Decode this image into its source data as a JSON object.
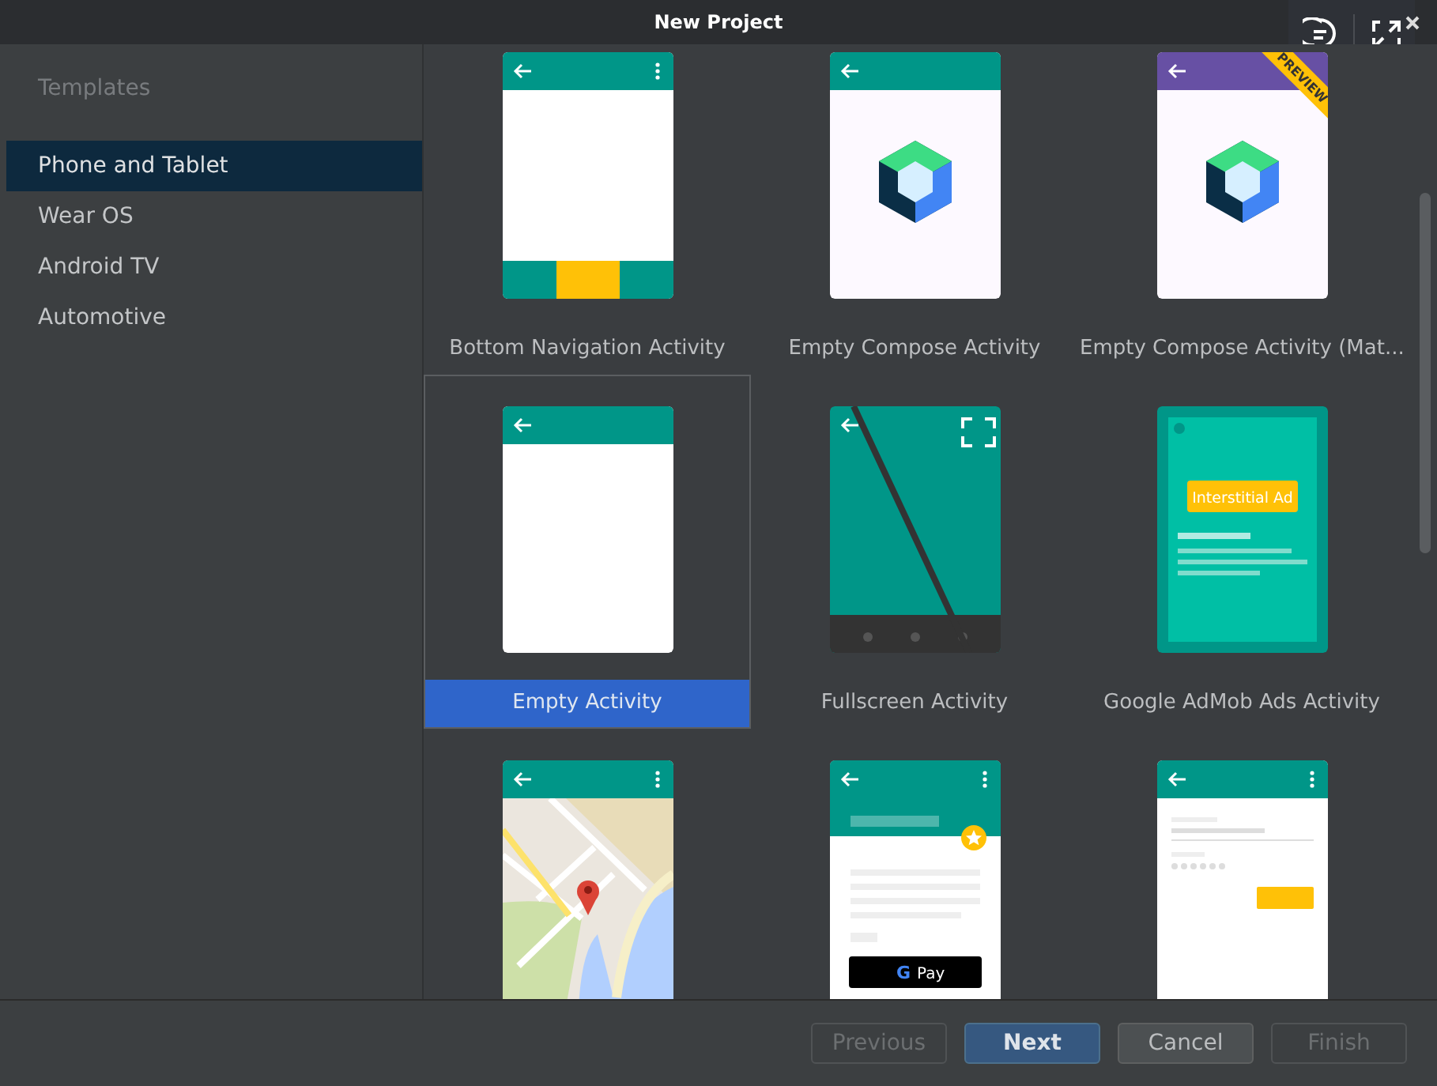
{
  "window": {
    "title": "New Project"
  },
  "sidebar": {
    "header": "Templates",
    "items": [
      {
        "label": "Phone and Tablet",
        "selected": true
      },
      {
        "label": "Wear OS",
        "selected": false
      },
      {
        "label": "Android TV",
        "selected": false
      },
      {
        "label": "Automotive",
        "selected": false
      }
    ]
  },
  "templates": [
    {
      "kind": "bottom_nav",
      "label": "Bottom Navigation Activity",
      "selected": false
    },
    {
      "kind": "compose",
      "label": "Empty Compose Activity",
      "selected": false
    },
    {
      "kind": "compose_preview",
      "label": "Empty Compose Activity (Mat...",
      "selected": false,
      "badge": "PREVIEW"
    },
    {
      "kind": "empty",
      "label": "Empty Activity",
      "selected": true
    },
    {
      "kind": "fullscreen",
      "label": "Fullscreen Activity",
      "selected": false
    },
    {
      "kind": "admob",
      "label": "Google AdMob Ads Activity",
      "selected": false,
      "ad_text": "Interstitial Ad"
    },
    {
      "kind": "maps",
      "selected": false
    },
    {
      "kind": "gpay",
      "selected": false,
      "pay_logo": "G",
      "pay_text": "Pay"
    },
    {
      "kind": "login",
      "selected": false
    }
  ],
  "buttons": [
    {
      "label": "Previous",
      "disabled": true,
      "primary": false
    },
    {
      "label": "Next",
      "disabled": false,
      "primary": true
    },
    {
      "label": "Cancel",
      "disabled": false,
      "primary": false
    },
    {
      "label": "Finish",
      "disabled": true,
      "primary": false
    }
  ]
}
